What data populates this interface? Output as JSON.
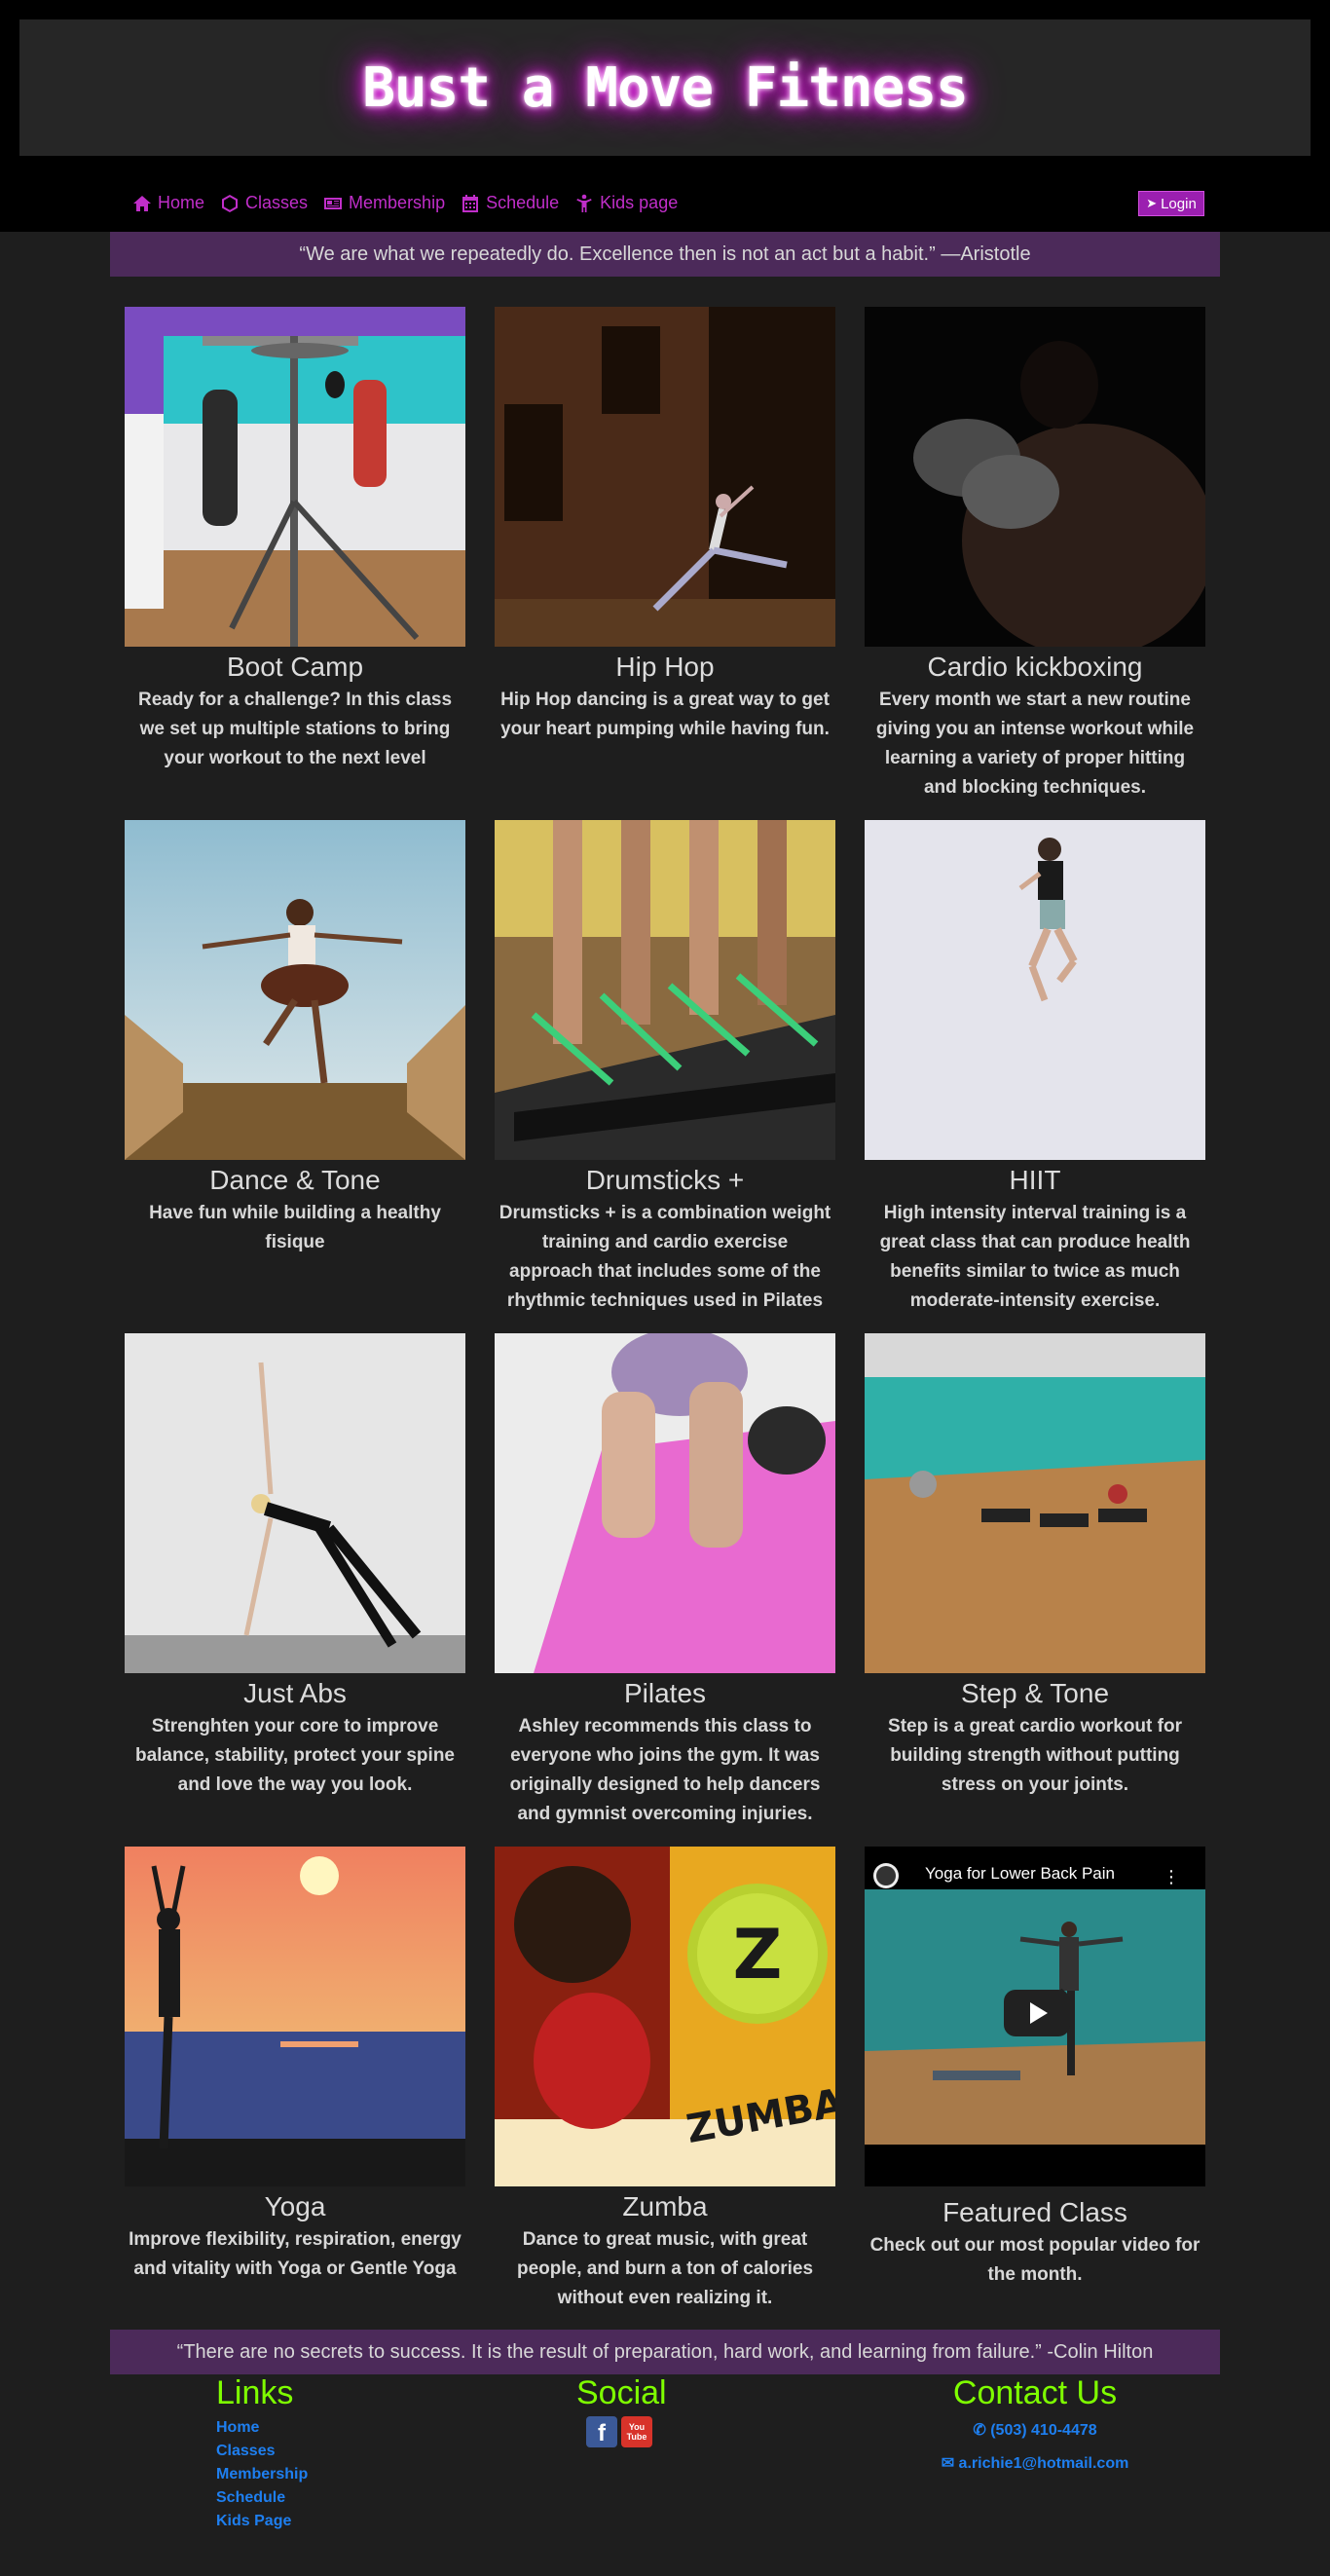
{
  "header": {
    "title": "Bust a Move Fitness"
  },
  "nav": {
    "items": [
      {
        "label": "Home",
        "icon": "home-icon"
      },
      {
        "label": "Classes",
        "icon": "hexagon-icon"
      },
      {
        "label": "Membership",
        "icon": "id-card-icon"
      },
      {
        "label": "Schedule",
        "icon": "calendar-icon"
      },
      {
        "label": "Kids page",
        "icon": "child-icon"
      }
    ],
    "login_label": "Login"
  },
  "quote_top": "“We are what we repeatedly do. Excellence then is not an act but a habit.” —Aristotle",
  "classes": [
    {
      "title": "Boot Camp",
      "desc": "Ready for a challenge? In this class we set up multiple stations to bring your workout to the next level"
    },
    {
      "title": "Hip Hop",
      "desc": "Hip Hop dancing is a great way to get your heart pumping while having fun."
    },
    {
      "title": "Cardio kickboxing",
      "desc": "Every month we start a new routine giving you an intense workout while learning a variety of proper hitting and blocking techniques."
    },
    {
      "title": "Dance & Tone",
      "desc": "Have fun while building a healthy fisique"
    },
    {
      "title": "Drumsticks +",
      "desc": "Drumsticks + is a combination weight training and cardio exercise approach that includes some of the rhythmic techniques used in Pilates"
    },
    {
      "title": "HIIT",
      "desc": "High intensity interval training is a great class that can produce health benefits similar to twice as much moderate-intensity exercise."
    },
    {
      "title": "Just Abs",
      "desc": "Strenghten your core to improve balance, stability, protect your spine and love the way you look."
    },
    {
      "title": "Pilates",
      "desc": "Ashley recommends this class to everyone who joins the gym. It was originally designed to help dancers and gymnist overcoming injuries."
    },
    {
      "title": "Step & Tone",
      "desc": "Step is a great cardio workout for building strength without putting stress on your joints."
    },
    {
      "title": "Yoga",
      "desc": "Improve flexibility, respiration, energy and vitality with Yoga or Gentle Yoga"
    },
    {
      "title": "Zumba",
      "desc": "Dance to great music, with great people, and burn a ton of calories without even realizing it."
    },
    {
      "title": "Featured Class",
      "desc": "Check out our most popular video for the month."
    }
  ],
  "video": {
    "title": "Yoga for Lower Back Pain"
  },
  "quote_bottom": "“There are no secrets to success. It is the result of preparation, hard work, and learning from failure.” -Colin Hilton",
  "footer": {
    "links_title": "Links",
    "links": [
      "Home",
      "Classes",
      "Membership",
      "Schedule",
      "Kids Page"
    ],
    "social_title": "Social",
    "contact_title": "Contact Us",
    "phone": "(503) 410-4478",
    "email": "a.richie1@hotmail.com"
  },
  "colors": {
    "accent": "#c02ec9",
    "quote_bg": "#4c2a5a",
    "footer_head": "#7fff00",
    "link": "#1e7ff0"
  }
}
